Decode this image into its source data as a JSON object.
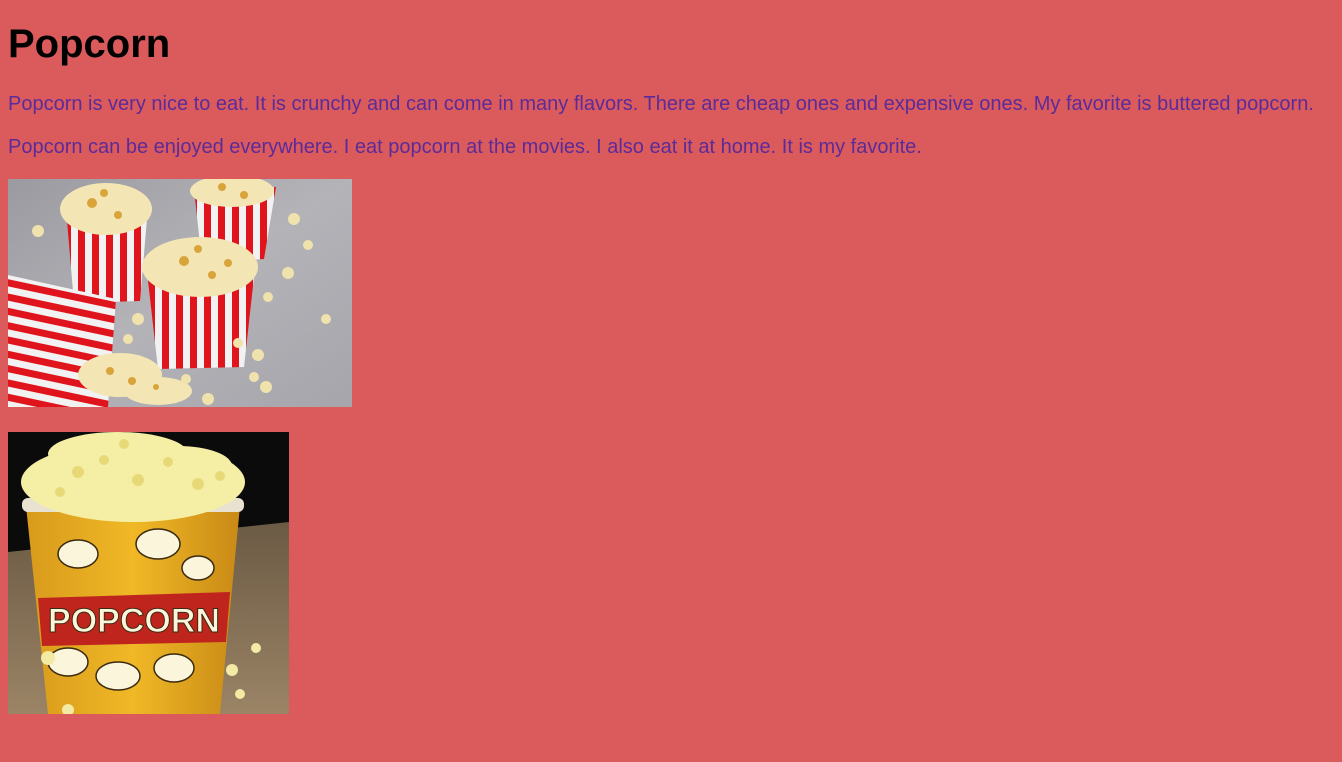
{
  "page": {
    "title": "Popcorn",
    "paragraphs": [
      "Popcorn is very nice to eat. It is crunchy and can come in many flavors. There are cheap ones and expensive ones. My favorite is buttered popcorn.",
      "Popcorn can be enjoyed everywhere. I eat popcorn at the movies. I also eat it at home. It is my favorite."
    ],
    "images": [
      {
        "subject": "striped popcorn boxes on grey surface"
      },
      {
        "subject": "popcorn bucket on burlap",
        "bucket_text": "POPCORN"
      }
    ]
  },
  "colors": {
    "background": "#db5b5d",
    "heading": "#000000",
    "paragraph": "#5b2b99"
  }
}
